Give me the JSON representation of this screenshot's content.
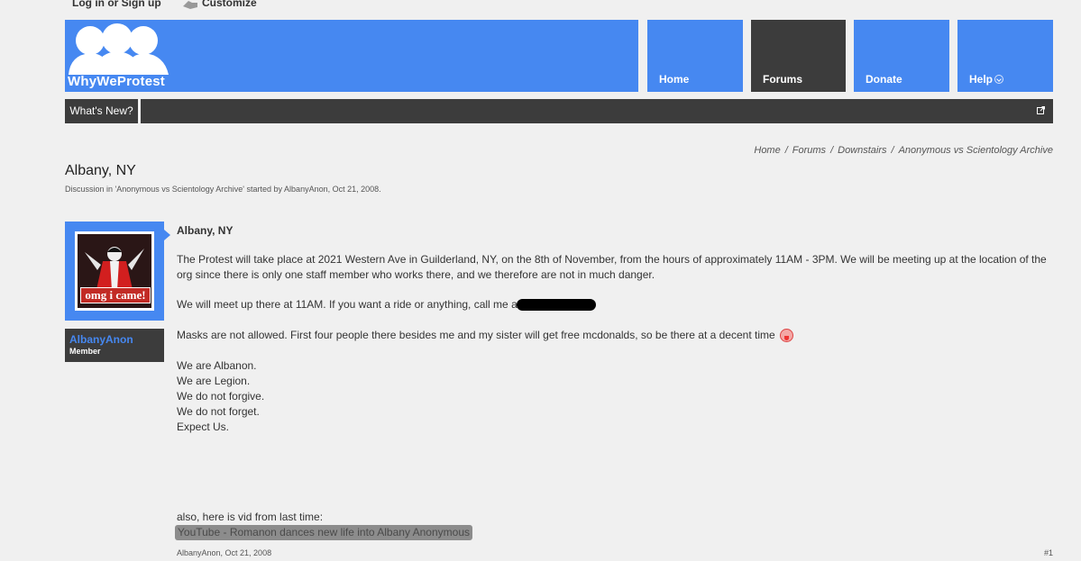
{
  "topbar": {
    "login_label": "Log in or Sign up",
    "customize_label": "Customize"
  },
  "header": {
    "logo_text": "WhyWeProtest"
  },
  "nav": {
    "tabs": [
      {
        "label": "Home"
      },
      {
        "label": "Forums"
      },
      {
        "label": "Donate"
      },
      {
        "label": "Help"
      }
    ],
    "whats_new": "What's New?"
  },
  "breadcrumb": [
    "Home",
    "Forums",
    "Downstairs",
    "Anonymous vs Scientology Archive"
  ],
  "thread": {
    "title": "Albany, NY",
    "description": "Discussion in 'Anonymous vs Scientology Archive' started by AlbanyAnon, Oct 21, 2008."
  },
  "user": {
    "name": "AlbanyAnon",
    "title": "Member",
    "avatar_caption": "omg i came!"
  },
  "post": {
    "title": "Albany, NY",
    "p1": "The Protest will take place at 2021 Western Ave in Guilderland, NY, on the 8th of November, from the hours of approximately 11AM - 3PM. We will be meeting up at the location of the org since there is only one staff member who works there, and we therefore are not in much danger.",
    "p2": "We will meet up there at 11AM. If you want a ride or anything, call me at",
    "p3": "Masks are not allowed. First four people there besides me and my sister will get free mcdonalds, so be there at a decent time",
    "lines": [
      "We are Albanon.",
      "We are Legion.",
      "We do not forgive.",
      "We do not forget.",
      "Expect Us."
    ],
    "also": "also, here is vid from last time:",
    "link": "YouTube - Romanon dances new life into Albany Anonymous",
    "meta": "AlbanyAnon, Oct 21, 2008",
    "number": "#1"
  }
}
